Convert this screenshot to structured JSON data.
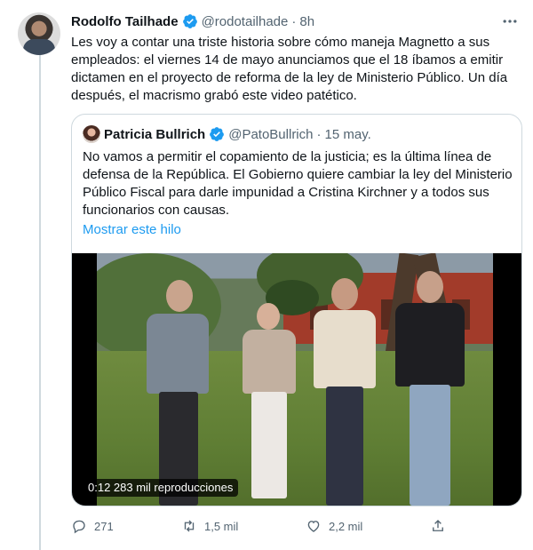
{
  "tweet": {
    "author_name": "Rodolfo Tailhade",
    "handle": "@rodotailhade",
    "separator": "·",
    "time": "8h",
    "text": "Les voy a contar una triste historia sobre cómo maneja Magnetto a sus empleados: el viernes 14 de mayo anunciamos que el 18 íbamos a emitir dictamen en el proyecto de reforma de la ley de Ministerio Público. Un día después, el macrismo grabó este video patético.",
    "more_icon": "more-horizontal-icon"
  },
  "quoted": {
    "author_name": "Patricia Bullrich",
    "handle": "@PatoBullrich",
    "separator": "·",
    "time": "15 may.",
    "text": "No vamos a permitir el copamiento de la justicia; es la última línea de defensa de la República. El Gobierno quiere cambiar la ley del Ministerio Público Fiscal para darle impunidad a Cristina Kirchner y a todos sus funcionarios  con causas.",
    "show_thread": "Mostrar este hilo",
    "video": {
      "badge": "0:12  283 mil reproducciones"
    }
  },
  "actions": {
    "reply_count": "271",
    "retweet_count": "1,5 mil",
    "like_count": "2,2 mil"
  },
  "colors": {
    "verified": "#1d9bf0",
    "link": "#1d9bf0",
    "muted": "#536471"
  }
}
